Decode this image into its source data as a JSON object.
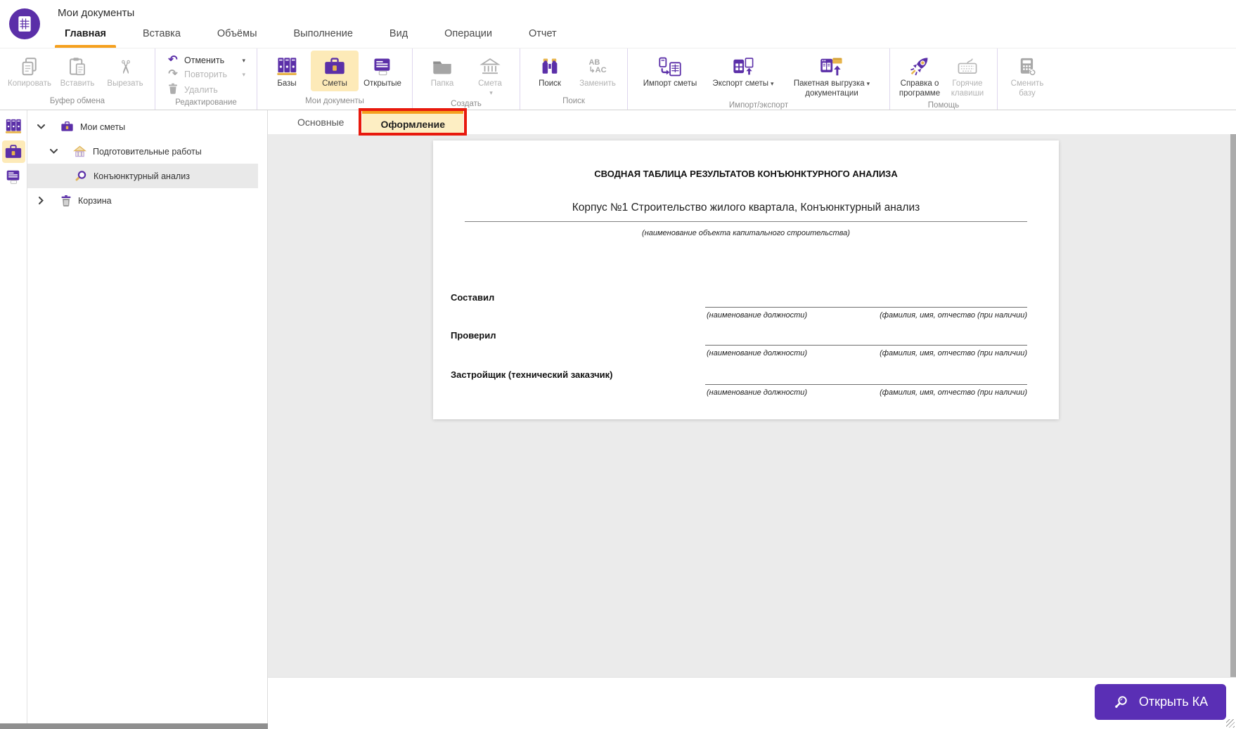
{
  "titlebar": {
    "app_title": "Мои документы",
    "menu_tabs": [
      "Главная",
      "Вставка",
      "Объёмы",
      "Выполнение",
      "Вид",
      "Операции",
      "Отчет"
    ]
  },
  "ribbon": {
    "groups": [
      {
        "label": "Буфер обмена",
        "buttons": [
          {
            "label": "Копировать"
          },
          {
            "label": "Вставить"
          },
          {
            "label": "Вырезать"
          }
        ]
      },
      {
        "label": "Редактирование",
        "buttons": [
          {
            "label": "Отменить"
          },
          {
            "label": "Повторить"
          },
          {
            "label": "Удалить"
          }
        ]
      },
      {
        "label": "Мои документы",
        "buttons": [
          {
            "label": "Базы"
          },
          {
            "label": "Сметы"
          },
          {
            "label": "Открытые"
          }
        ]
      },
      {
        "label": "Создать",
        "buttons": [
          {
            "label": "Папка"
          },
          {
            "label": "Смета"
          }
        ]
      },
      {
        "label": "Поиск",
        "buttons": [
          {
            "label": "Поиск"
          },
          {
            "label": "Заменить"
          }
        ]
      },
      {
        "label": "Импорт/экспорт",
        "buttons": [
          {
            "label": "Импорт сметы"
          },
          {
            "label": "Экспорт сметы"
          },
          {
            "label": "Пакетная выгрузка",
            "label2": "документации"
          }
        ]
      },
      {
        "label": "Помощь",
        "buttons": [
          {
            "label": "Справка о",
            "label2": "программе"
          },
          {
            "label": "Горячие",
            "label2": "клавиши"
          }
        ]
      },
      {
        "label": "",
        "buttons": [
          {
            "label": "Сменить",
            "label2": "базу"
          }
        ]
      }
    ]
  },
  "content": {
    "tabs": [
      {
        "label": "Основные"
      },
      {
        "label": "Оформление"
      }
    ]
  },
  "sidebar": {
    "tree": [
      {
        "label": "Мои сметы"
      },
      {
        "label": "Подготовительные работы"
      },
      {
        "label": "Конъюнктурный анализ"
      },
      {
        "label": "Корзина"
      }
    ]
  },
  "document": {
    "title": "СВОДНАЯ ТАБЛИЦА РЕЗУЛЬТАТОВ КОНЪЮНКТУРНОГО АНАЛИЗА",
    "object_name": "Корпус №1 Строительство жилого квартала, Конъюнктурный анализ",
    "object_caption": "(наименование объекта капитального строительства)",
    "signature_rows": [
      {
        "label": "Составил",
        "position_caption": "(наименование должности)",
        "name_caption": "(фамилия, имя, отчество (при наличии)"
      },
      {
        "label": "Проверил",
        "position_caption": "(наименование должности)",
        "name_caption": "(фамилия, имя, отчество (при наличии)"
      },
      {
        "label": "Застройщик (технический заказчик)",
        "position_caption": "(наименование должности)",
        "name_caption": "(фамилия, имя, отчество (при наличии)"
      }
    ]
  },
  "footer": {
    "open_button_label": "Открыть КА"
  },
  "icons": {
    "caret_down": "▾",
    "undo": "↶",
    "redo": "↷",
    "scissors": "✂",
    "replace_top": "AB",
    "replace_bottom": "↳AC"
  },
  "colors": {
    "brand_purple": "#5B2FA8",
    "accent_orange": "#F5A01E",
    "selection_cream": "#FDEAB8",
    "button_purple": "#5A2FB5",
    "annotation_red": "#E8190D",
    "icon_yellow": "#E8B54C"
  }
}
